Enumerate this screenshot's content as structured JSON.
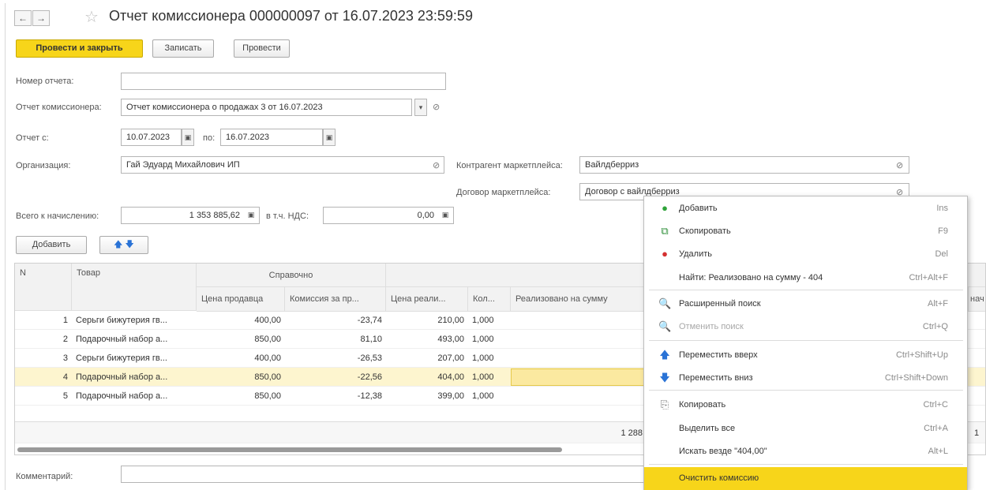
{
  "window": {
    "title": "Отчет комиссионера 000000097 от 16.07.2023 23:59:59",
    "back_glyph": "←",
    "forward_glyph": "→",
    "star_glyph": "☆"
  },
  "toolbar": {
    "post_close": "Провести и закрыть",
    "save": "Записать",
    "post": "Провести"
  },
  "form": {
    "report_number_label": "Номер отчета:",
    "report_number_value": "",
    "commission_report_label": "Отчет комиссионера:",
    "commission_report_value": "Отчет комиссионера о продажах 3 от 16.07.2023",
    "period_from_label": "Отчет с:",
    "period_from_value": "10.07.2023",
    "period_to_label": "по:",
    "period_to_value": "16.07.2023",
    "organization_label": "Организация:",
    "organization_value": "Гай Эдуард Михайлович ИП",
    "contractor_label": "Контрагент маркетплейса:",
    "contractor_value": "Вайлдберриз",
    "contract_label": "Договор маркетплейса:",
    "contract_value": "Договор с вайлдберриз",
    "total_label": "Всего к начислению:",
    "total_value": "1 353 885,62",
    "vat_label": "в т.ч. НДС:",
    "vat_value": "0,00",
    "comment_label": "Комментарий:",
    "comment_value": ""
  },
  "table_toolbar": {
    "add": "Добавить",
    "up_glyph": "🡅",
    "down_glyph": "🡇"
  },
  "table": {
    "headers": {
      "n": "N",
      "product": "Товар",
      "reference_group": "Справочно",
      "seller_price": "Цена продавца",
      "commission": "Комиссия за пр...",
      "sale_price": "Цена реали...",
      "qty": "Кол...",
      "sold_sum": "Реализовано на сумму",
      "accrued_cut": "нач"
    },
    "rows": [
      {
        "n": "1",
        "product": "Серьги бижутерия гв...",
        "seller_price": "400,00",
        "commission": "-23,74",
        "sale_price": "210,00",
        "qty": "1,000"
      },
      {
        "n": "2",
        "product": "Подарочный набор а...",
        "seller_price": "850,00",
        "commission": "81,10",
        "sale_price": "493,00",
        "qty": "1,000"
      },
      {
        "n": "3",
        "product": "Серьги бижутерия гв...",
        "seller_price": "400,00",
        "commission": "-26,53",
        "sale_price": "207,00",
        "qty": "1,000"
      },
      {
        "n": "4",
        "product": "Подарочный набор а...",
        "seller_price": "850,00",
        "commission": "-22,56",
        "sale_price": "404,00",
        "qty": "1,000"
      },
      {
        "n": "5",
        "product": "Подарочный набор а...",
        "seller_price": "850,00",
        "commission": "-12,38",
        "sale_price": "399,00",
        "qty": "1,000"
      }
    ],
    "selected_row": 4,
    "footer_sum": "1 288",
    "footer_right": "1"
  },
  "context_menu": {
    "items": [
      {
        "label": "Добавить",
        "shortcut": "Ins",
        "icon": "add-icon",
        "glyph": "●",
        "color": "#2fa33a"
      },
      {
        "label": "Скопировать",
        "shortcut": "F9",
        "icon": "copy-row-icon",
        "glyph": "⧉",
        "color": "#2f8f3a"
      },
      {
        "label": "Удалить",
        "shortcut": "Del",
        "icon": "delete-icon",
        "glyph": "●",
        "color": "#d43030"
      },
      {
        "label": "Найти: Реализовано на сумму - 404",
        "shortcut": "Ctrl+Alt+F",
        "icon": "",
        "glyph": "",
        "color": ""
      },
      {
        "label": "Расширенный поиск",
        "shortcut": "Alt+F",
        "icon": "search-icon",
        "glyph": "🔍",
        "color": "#2a66c4"
      },
      {
        "label": "Отменить поиск",
        "shortcut": "Ctrl+Q",
        "icon": "cancel-search-icon",
        "glyph": "🔍",
        "color": "#b8b8b8"
      },
      {
        "label": "Переместить вверх",
        "shortcut": "Ctrl+Shift+Up",
        "icon": "arrow-up-icon",
        "glyph": "🡅",
        "color": "#2a73d6"
      },
      {
        "label": "Переместить вниз",
        "shortcut": "Ctrl+Shift+Down",
        "icon": "arrow-down-icon",
        "glyph": "🡇",
        "color": "#2a73d6"
      },
      {
        "label": "Копировать",
        "shortcut": "Ctrl+C",
        "icon": "copy-icon",
        "glyph": "⎘",
        "color": "#777777"
      },
      {
        "label": "Выделить все",
        "shortcut": "Ctrl+A",
        "icon": "",
        "glyph": "",
        "color": ""
      },
      {
        "label": "Искать везде \"404,00\"",
        "shortcut": "Alt+L",
        "icon": "",
        "glyph": "",
        "color": ""
      },
      {
        "label": "Очистить комиссию",
        "shortcut": "",
        "icon": "",
        "glyph": "",
        "color": ""
      }
    ],
    "highlighted_item": "Очистить комиссию",
    "disabled_item": "Отменить поиск"
  },
  "colors": {
    "accent_yellow": "#f7d51a",
    "selected_row": "#fdf5cf",
    "edit_cell": "#fbe9a0"
  }
}
